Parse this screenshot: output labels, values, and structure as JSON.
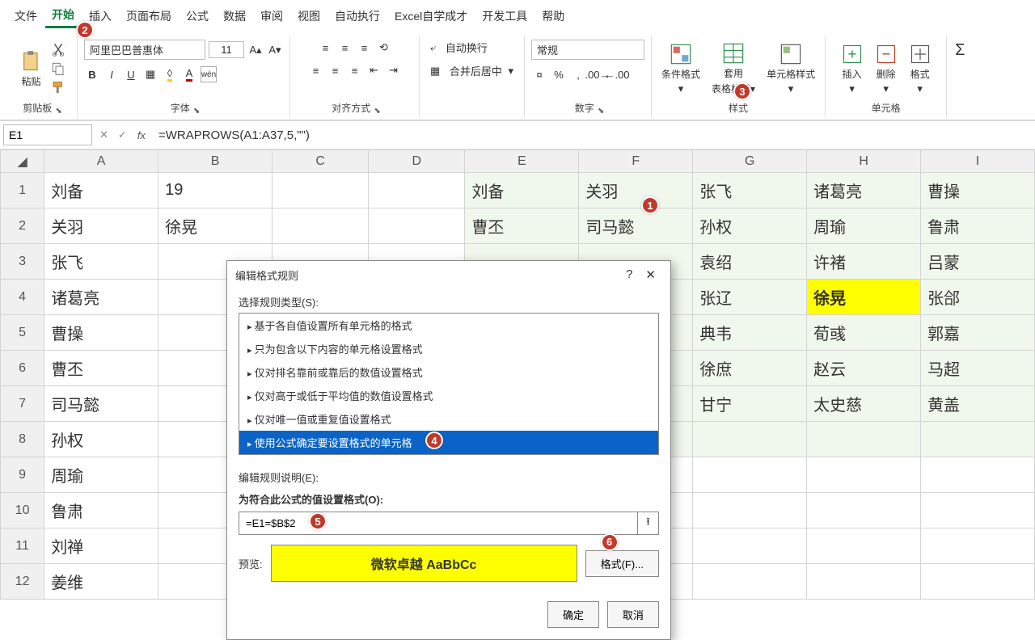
{
  "menu": {
    "items": [
      "文件",
      "开始",
      "插入",
      "页面布局",
      "公式",
      "数据",
      "审阅",
      "视图",
      "自动执行",
      "Excel自学成才",
      "开发工具",
      "帮助"
    ],
    "activeIndex": 1
  },
  "ribbon": {
    "clipboard_label": "剪贴板",
    "paste_label": "粘贴",
    "font_group_label": "字体",
    "font_name": "阿里巴巴普惠体",
    "font_size": "11",
    "align_group_label": "对齐方式",
    "wrap_label": "自动换行",
    "merge_label": "合并后居中",
    "number_group_label": "数字",
    "number_format": "常规",
    "styles_group_label": "样式",
    "cond_format_label": "条件格式",
    "table_format_label1": "套用",
    "table_format_label2": "表格格式",
    "cell_style_label": "单元格样式",
    "cells_group_label": "单元格",
    "insert_label": "插入",
    "delete_label": "删除",
    "format_label": "格式"
  },
  "formula_bar": {
    "name_box": "E1",
    "formula": "=WRAPROWS(A1:A37,5,\"\")"
  },
  "grid": {
    "columns": [
      "A",
      "B",
      "C",
      "D",
      "E",
      "F",
      "G",
      "H",
      "I"
    ],
    "selectedCols": [
      "E",
      "F",
      "G",
      "H",
      "I"
    ],
    "rows": [
      {
        "n": 1,
        "A": "刘备",
        "B": "19",
        "E": "刘备",
        "F": "关羽",
        "G": "张飞",
        "H": "诸葛亮",
        "I": "曹操"
      },
      {
        "n": 2,
        "A": "关羽",
        "B": "徐晃",
        "E": "曹丕",
        "F": "司马懿",
        "G": "孙权",
        "H": "周瑜",
        "I": "鲁肃"
      },
      {
        "n": 3,
        "A": "张飞",
        "G": "袁绍",
        "H": "许褚",
        "I": "吕蒙"
      },
      {
        "n": 4,
        "A": "诸葛亮",
        "G": "张辽",
        "H": "徐晃",
        "I": "张郃",
        "H_hl": true
      },
      {
        "n": 5,
        "A": "曹操",
        "G": "典韦",
        "H": "荀彧",
        "I": "郭嘉"
      },
      {
        "n": 6,
        "A": "曹丕",
        "G": "徐庶",
        "H": "赵云",
        "I": "马超"
      },
      {
        "n": 7,
        "A": "司马懿",
        "G": "甘宁",
        "H": "太史慈",
        "I": "黄盖"
      },
      {
        "n": 8,
        "A": "孙权"
      },
      {
        "n": 9,
        "A": "周瑜"
      },
      {
        "n": 10,
        "A": "鲁肃"
      },
      {
        "n": 11,
        "A": "刘禅"
      },
      {
        "n": 12,
        "A": "姜维"
      }
    ]
  },
  "dialog": {
    "title": "编辑格式规则",
    "select_type_label": "选择规则类型(S):",
    "rule_types": [
      "基于各自值设置所有单元格的格式",
      "只为包含以下内容的单元格设置格式",
      "仅对排名靠前或靠后的数值设置格式",
      "仅对高于或低于平均值的数值设置格式",
      "仅对唯一值或重复值设置格式",
      "使用公式确定要设置格式的单元格"
    ],
    "rule_selected_index": 5,
    "edit_desc_label": "编辑规则说明(E):",
    "formula_label": "为符合此公式的值设置格式(O):",
    "formula_value": "=E1=$B$2",
    "preview_label": "预览:",
    "preview_text": "微软卓越 AaBbCc",
    "format_btn": "格式(F)...",
    "ok": "确定",
    "cancel": "取消"
  },
  "badges": {
    "b1": "1",
    "b2": "2",
    "b3": "3",
    "b4": "4",
    "b5": "5",
    "b6": "6"
  }
}
